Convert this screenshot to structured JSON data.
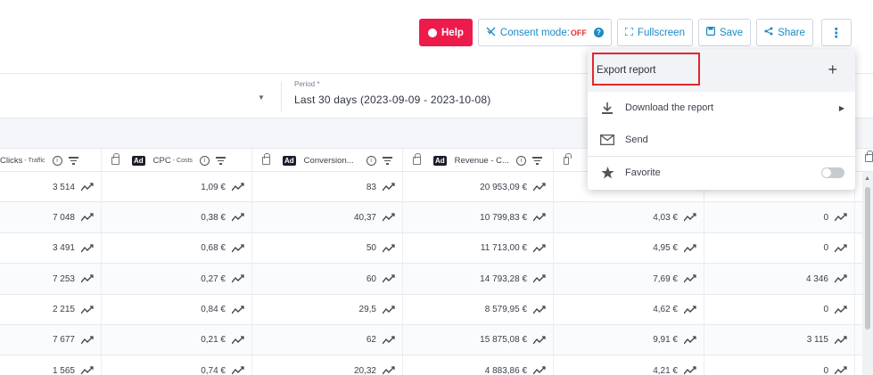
{
  "toolbar": {
    "help_label": "Help",
    "consent_label": "Consent mode:",
    "consent_state": "OFF",
    "fullscreen_label": "Fullscreen",
    "save_label": "Save",
    "share_label": "Share",
    "more_icon": "⋮"
  },
  "filters": {
    "period_label": "Period *",
    "period_value": "Last 30 days  (2023-09-09 - 2023-10-08)"
  },
  "menu": {
    "export_label": "Export report",
    "download_label": "Download the report",
    "send_label": "Send",
    "favorite_label": "Favorite",
    "favorite_on": false
  },
  "table": {
    "headers": [
      {
        "label": "Clicks",
        "sub": "- Traffic",
        "ad": false
      },
      {
        "label": "CPC",
        "sub": "- Costs",
        "ad": true
      },
      {
        "label": "Conversion...",
        "sub": "",
        "ad": true
      },
      {
        "label": "Revenue - C...",
        "sub": "",
        "ad": true
      }
    ],
    "rows": [
      [
        "3 514",
        "1,09 €",
        "83",
        "20 953,09 €",
        "",
        ""
      ],
      [
        "7 048",
        "0,38 €",
        "40,37",
        "10 799,83 €",
        "4,03 €",
        "0"
      ],
      [
        "3 491",
        "0,68 €",
        "50",
        "11 713,00 €",
        "4,95 €",
        "0"
      ],
      [
        "7 253",
        "0,27 €",
        "60",
        "14 793,28 €",
        "7,69 €",
        "4 346"
      ],
      [
        "2 215",
        "0,84 €",
        "29,5",
        "8 579,95 €",
        "4,62 €",
        "0"
      ],
      [
        "7 677",
        "0,21 €",
        "62",
        "15 875,08 €",
        "9,91 €",
        "3 115"
      ],
      [
        "1 565",
        "0,74 €",
        "20,32",
        "4 883,86 €",
        "4,21 €",
        "0"
      ]
    ]
  },
  "colors": {
    "help_bg": "#ec1b4b",
    "accent": "#1a8ac6",
    "highlight": "#e3262d"
  }
}
